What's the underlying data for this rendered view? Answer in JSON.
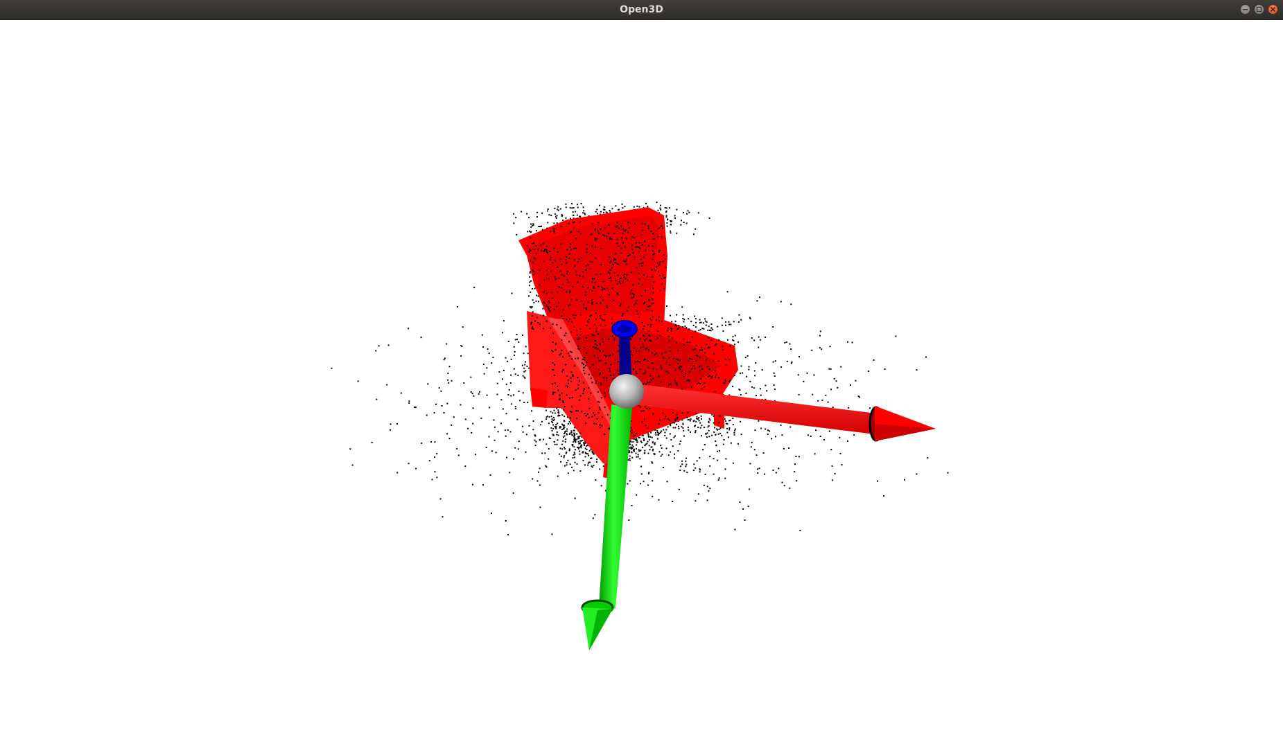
{
  "window": {
    "title": "Open3D",
    "controls": {
      "minimize_icon": "minimize-icon",
      "maximize_icon": "maximize-icon",
      "close_icon": "close-icon"
    }
  },
  "scene": {
    "background_color": "#ffffff",
    "point_color": "#000000",
    "object": "chair",
    "object_color": "#ff0000",
    "axes": {
      "x_color": "#ff0000",
      "y_color": "#00ff00",
      "z_color": "#0000ff",
      "origin_color": "#c0c0c0"
    }
  }
}
